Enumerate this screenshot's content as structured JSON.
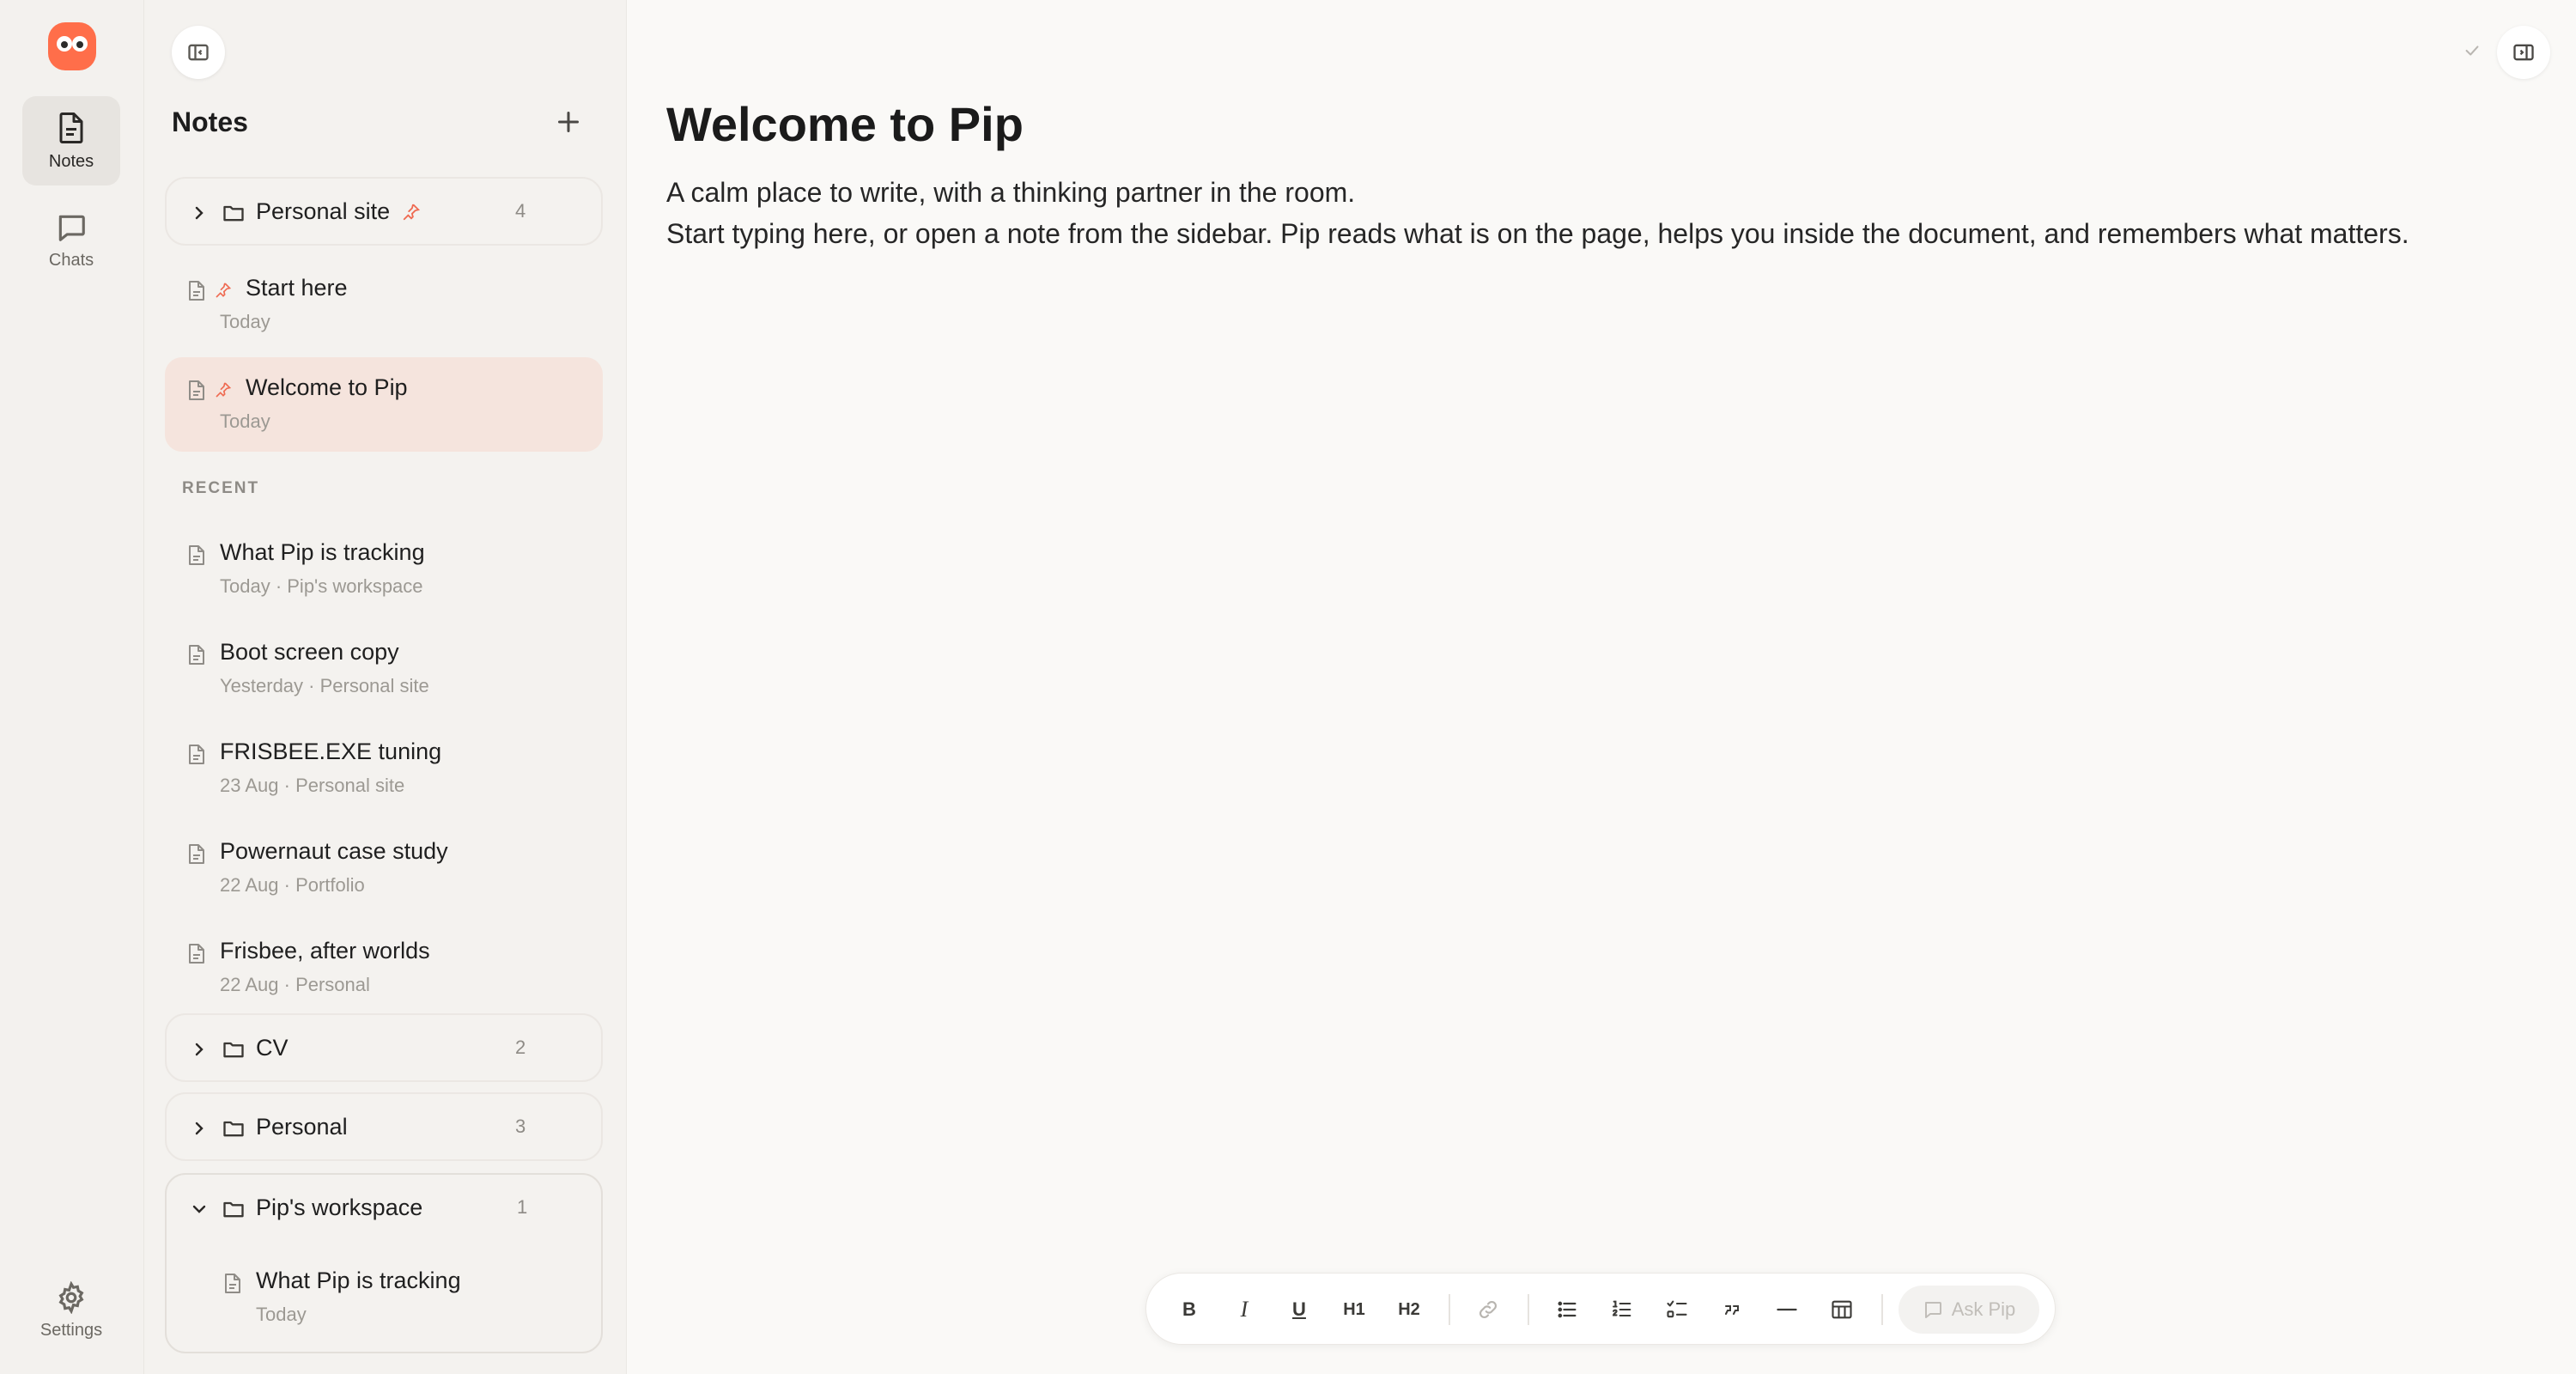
{
  "rail": {
    "notes_label": "Notes",
    "chats_label": "Chats",
    "settings_label": "Settings"
  },
  "sidebar": {
    "title": "Notes",
    "recent_label": "RECENT",
    "folders": [
      {
        "name": "Personal site",
        "count": "4",
        "pinned": true
      },
      {
        "name": "CV",
        "count": "2",
        "pinned": false
      },
      {
        "name": "Personal",
        "count": "3",
        "pinned": false
      },
      {
        "name": "Pip's workspace",
        "count": "1",
        "pinned": false
      }
    ],
    "pinned_notes": [
      {
        "title": "Start here",
        "meta": "Today"
      },
      {
        "title": "Welcome to Pip",
        "meta": "Today"
      }
    ],
    "recent_notes": [
      {
        "title": "What Pip is tracking",
        "meta": "Today · Pip's workspace"
      },
      {
        "title": "Boot screen copy",
        "meta": "Yesterday · Personal site"
      },
      {
        "title": "FRISBEE.EXE tuning",
        "meta": "23 Aug · Personal site"
      },
      {
        "title": "Powernaut case study",
        "meta": "22 Aug · Portfolio"
      },
      {
        "title": "Frisbee, after worlds",
        "meta": "22 Aug · Personal"
      }
    ],
    "workspace_notes": [
      {
        "title": "What Pip is tracking",
        "meta": "Today"
      }
    ]
  },
  "editor": {
    "title": "Welcome to Pip",
    "lines": [
      "A calm place to write, with a thinking partner in the room.",
      "Start typing here, or open a note from the sidebar. Pip reads what is on the page, helps you inside the document, and remembers what matters."
    ]
  },
  "toolbar": {
    "bold": "B",
    "italic": "I",
    "underline": "U",
    "h1": "H1",
    "h2": "H2",
    "ask_pip": "Ask Pip"
  },
  "colors": {
    "accent": "#ff6e4a",
    "pin": "#ef6a51",
    "active_note_bg": "#f5e4dd"
  }
}
